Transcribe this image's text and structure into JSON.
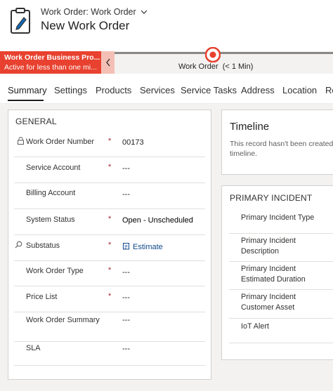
{
  "header": {
    "form_selector": "Work Order: Work Order",
    "title": "New Work Order"
  },
  "bpf": {
    "stage_title": "Work Order Business Pro...",
    "stage_status": "Active for less than one mi...",
    "active_stage": "Work Order",
    "duration": "(< 1 Min)"
  },
  "tabs": [
    "Summary",
    "Settings",
    "Products",
    "Services",
    "Service Tasks",
    "Address",
    "Location",
    "Re"
  ],
  "general": {
    "title": "GENERAL",
    "fields": {
      "work_order_number": {
        "label": "Work Order Number",
        "value": "00173"
      },
      "service_account": {
        "label": "Service Account",
        "value": "---"
      },
      "billing_account": {
        "label": "Billing Account",
        "value": "---"
      },
      "system_status": {
        "label": "System Status",
        "value": "Open - Unscheduled"
      },
      "substatus": {
        "label": "Substatus",
        "value": "Estimate"
      },
      "work_order_type": {
        "label": "Work Order Type",
        "value": "---"
      },
      "price_list": {
        "label": "Price List",
        "value": "---"
      },
      "work_order_summary": {
        "label": "Work Order Summary",
        "value": "---"
      },
      "sla": {
        "label": "SLA",
        "value": "---"
      }
    },
    "required_mark": "*"
  },
  "timeline": {
    "title": "Timeline",
    "text": "This record hasn't been created timeline."
  },
  "incident": {
    "title": "PRIMARY INCIDENT",
    "fields": {
      "type": {
        "label": "Primary Incident Type",
        "value": "-"
      },
      "description": {
        "label": "Primary Incident Description",
        "value": "-"
      },
      "duration": {
        "label": "Primary Incident Estimated Duration",
        "value": "-"
      },
      "asset": {
        "label": "Primary Incident Customer Asset",
        "value": "-"
      },
      "iot": {
        "label": "IoT Alert",
        "value": "-"
      }
    }
  },
  "colors": {
    "bpf_active": "#e8412f",
    "bpf_collapse": "#f4c0b6",
    "required": "#a4262c",
    "link": "#0f4a8a"
  }
}
